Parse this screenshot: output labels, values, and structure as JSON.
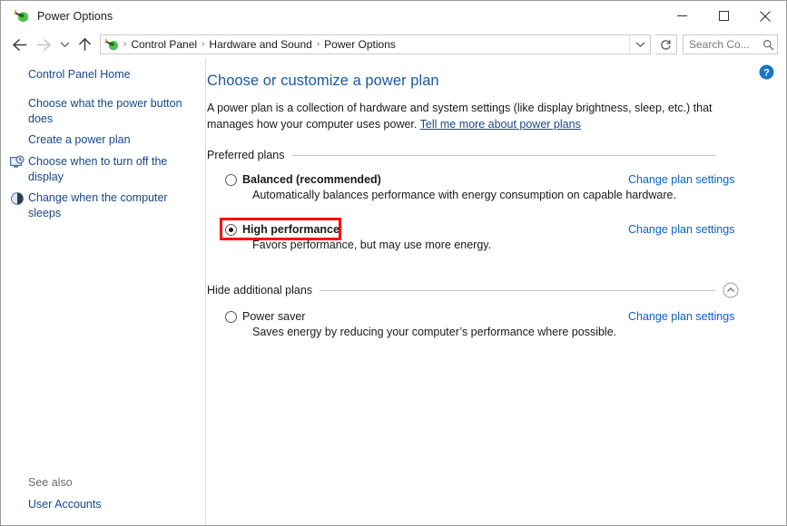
{
  "window": {
    "title": "Power Options",
    "icon": "power-plug-icon",
    "minimize_label": "Minimize",
    "maximize_label": "Maximize",
    "close_label": "Close"
  },
  "navbar": {
    "back_label": "Back",
    "forward_label": "Forward",
    "recent_label": "Recent locations",
    "up_label": "Up one level",
    "breadcrumbs": [
      {
        "label": "Control Panel"
      },
      {
        "label": "Hardware and Sound"
      },
      {
        "label": "Power Options"
      }
    ],
    "separator": "›",
    "address_dropdown_label": "Previous locations",
    "refresh_label": "Refresh",
    "search": {
      "placeholder": "Search Co...",
      "value": ""
    }
  },
  "sidebar": {
    "items": [
      {
        "label": "Control Panel Home",
        "icon": ""
      },
      {
        "label": "Choose what the power button does",
        "icon": ""
      },
      {
        "label": "Create a power plan",
        "icon": ""
      },
      {
        "label": "Choose when to turn off the display",
        "icon": "monitor-clock-icon"
      },
      {
        "label": "Change when the computer sleeps",
        "icon": "moon-sleep-icon"
      }
    ],
    "see_also": {
      "title": "See also",
      "links": [
        {
          "label": "User Accounts"
        }
      ]
    }
  },
  "main": {
    "help_label": "Help",
    "heading": "Choose or customize a power plan",
    "description_part1": "A power plan is a collection of hardware and system settings (like display brightness, sleep, etc.) that manages how your computer uses power. ",
    "description_link": "Tell me more about power plans",
    "groups": [
      {
        "label": "Preferred plans",
        "collapse_icon": "",
        "plans": [
          {
            "name": "Balanced (recommended)",
            "bold": true,
            "selected": false,
            "description": "Automatically balances performance with energy consumption on capable hardware.",
            "change_link": "Change plan settings",
            "highlighted": false
          },
          {
            "name": "High performance",
            "bold": true,
            "selected": true,
            "description": "Favors performance, but may use more energy.",
            "change_link": "Change plan settings",
            "highlighted": true
          }
        ]
      },
      {
        "label": "Hide additional plans",
        "collapse_icon": "chevron-up-circle-icon",
        "plans": [
          {
            "name": "Power saver",
            "bold": false,
            "selected": false,
            "description": "Saves energy by reducing your computer’s performance where possible.",
            "change_link": "Change plan settings",
            "highlighted": false
          }
        ]
      }
    ]
  },
  "colors": {
    "heading_blue": "#19599e",
    "link_blue": "#0a60c8",
    "sidebar_link": "#16478a",
    "highlight_red": "#fa0a0a"
  }
}
